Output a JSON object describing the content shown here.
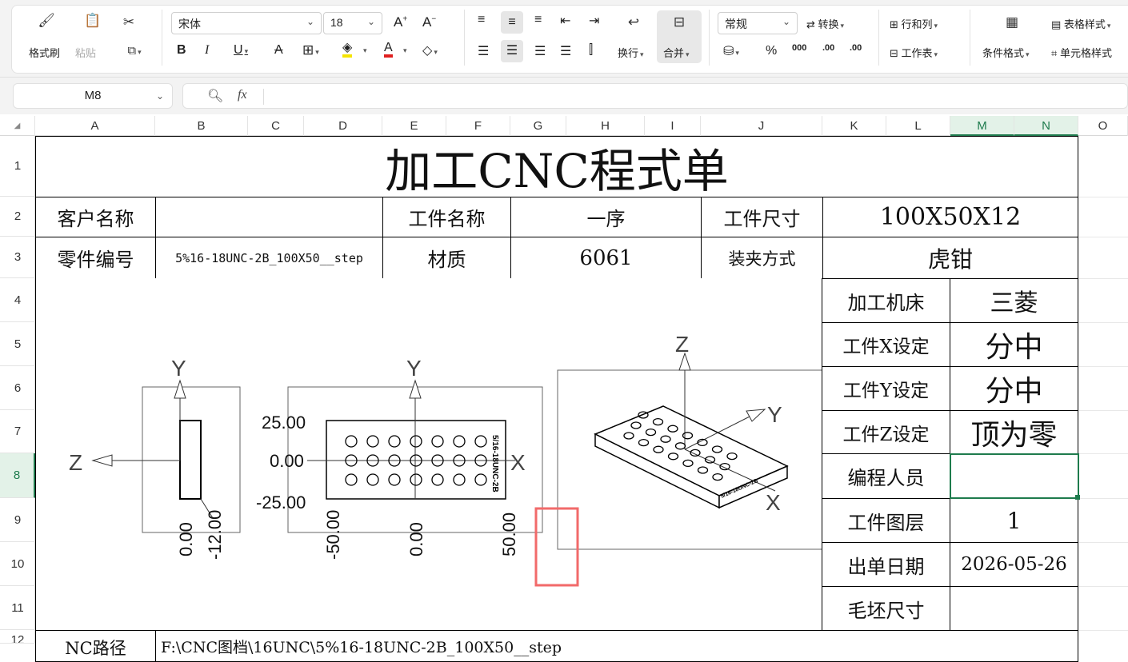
{
  "ribbon": {
    "format_painter": "格式刷",
    "paste": "粘贴",
    "font_name": "宋体",
    "font_size": "18",
    "wrap": "换行",
    "merge": "合并",
    "number_format": "常规",
    "convert": "转换",
    "row_col": "行和列",
    "worksheet": "工作表",
    "cond_format": "条件格式",
    "table_style": "表格样式",
    "cell_style": "单元格样式",
    "percent": "%",
    "thousands": "000",
    "dec_inc": ".00",
    "dec_dec": ".00"
  },
  "formula_bar": {
    "cell_ref": "M8",
    "fx": "fx",
    "value": ""
  },
  "columns": [
    "A",
    "B",
    "C",
    "D",
    "E",
    "F",
    "G",
    "H",
    "I",
    "J",
    "K",
    "L",
    "M",
    "N",
    "O"
  ],
  "active_column": "M",
  "rows": [
    "1",
    "2",
    "3",
    "4",
    "5",
    "6",
    "7",
    "8",
    "9",
    "10",
    "11",
    "12"
  ],
  "active_row": "8",
  "sheet": {
    "title": "加工CNC程式单",
    "customer_label": "客户名称",
    "customer_value": "",
    "part_name_label": "工件名称",
    "part_name_value": "一序",
    "part_size_label": "工件尺寸",
    "part_size_value": "100X50X12",
    "part_no_label": "零件编号",
    "part_no_value": "5%16-18UNC-2B_100X50__step",
    "material_label": "材质",
    "material_value": "6061",
    "clamp_label": "装夹方式",
    "clamp_value": "虎钳",
    "side_rows": [
      {
        "label": "加工机床",
        "value": "三菱"
      },
      {
        "label": "工件X设定",
        "value": "分中"
      },
      {
        "label": "工件Y设定",
        "value": "分中"
      },
      {
        "label": "工件Z设定",
        "value": "顶为零"
      },
      {
        "label": "编程人员",
        "value": ""
      },
      {
        "label": "工件图层",
        "value": "1"
      },
      {
        "label": "出单日期",
        "value": "2026-05-26"
      },
      {
        "label": "毛坯尺寸",
        "value": ""
      }
    ],
    "nc_path_label": "NC路径",
    "nc_path_value": "F:\\CNC图档\\16UNC\\5%16-18UNC-2B_100X50__step"
  },
  "drawing": {
    "axis_y": "Y",
    "axis_z": "Z",
    "axis_x": "X",
    "side_ticks": [
      "0.00",
      "-12.00"
    ],
    "front_y_ticks": [
      "25.00",
      "0.00",
      "-25.00"
    ],
    "front_x_ticks": [
      "-50.00",
      "0.00",
      "50.00"
    ],
    "plate_label": "5/16-18UNC-2B"
  },
  "colors": {
    "accent": "#1e7b4d",
    "highlight_box": "#f26a6a",
    "font_color_bar": "#e02020",
    "fill_color_bar": "#f5e400"
  }
}
